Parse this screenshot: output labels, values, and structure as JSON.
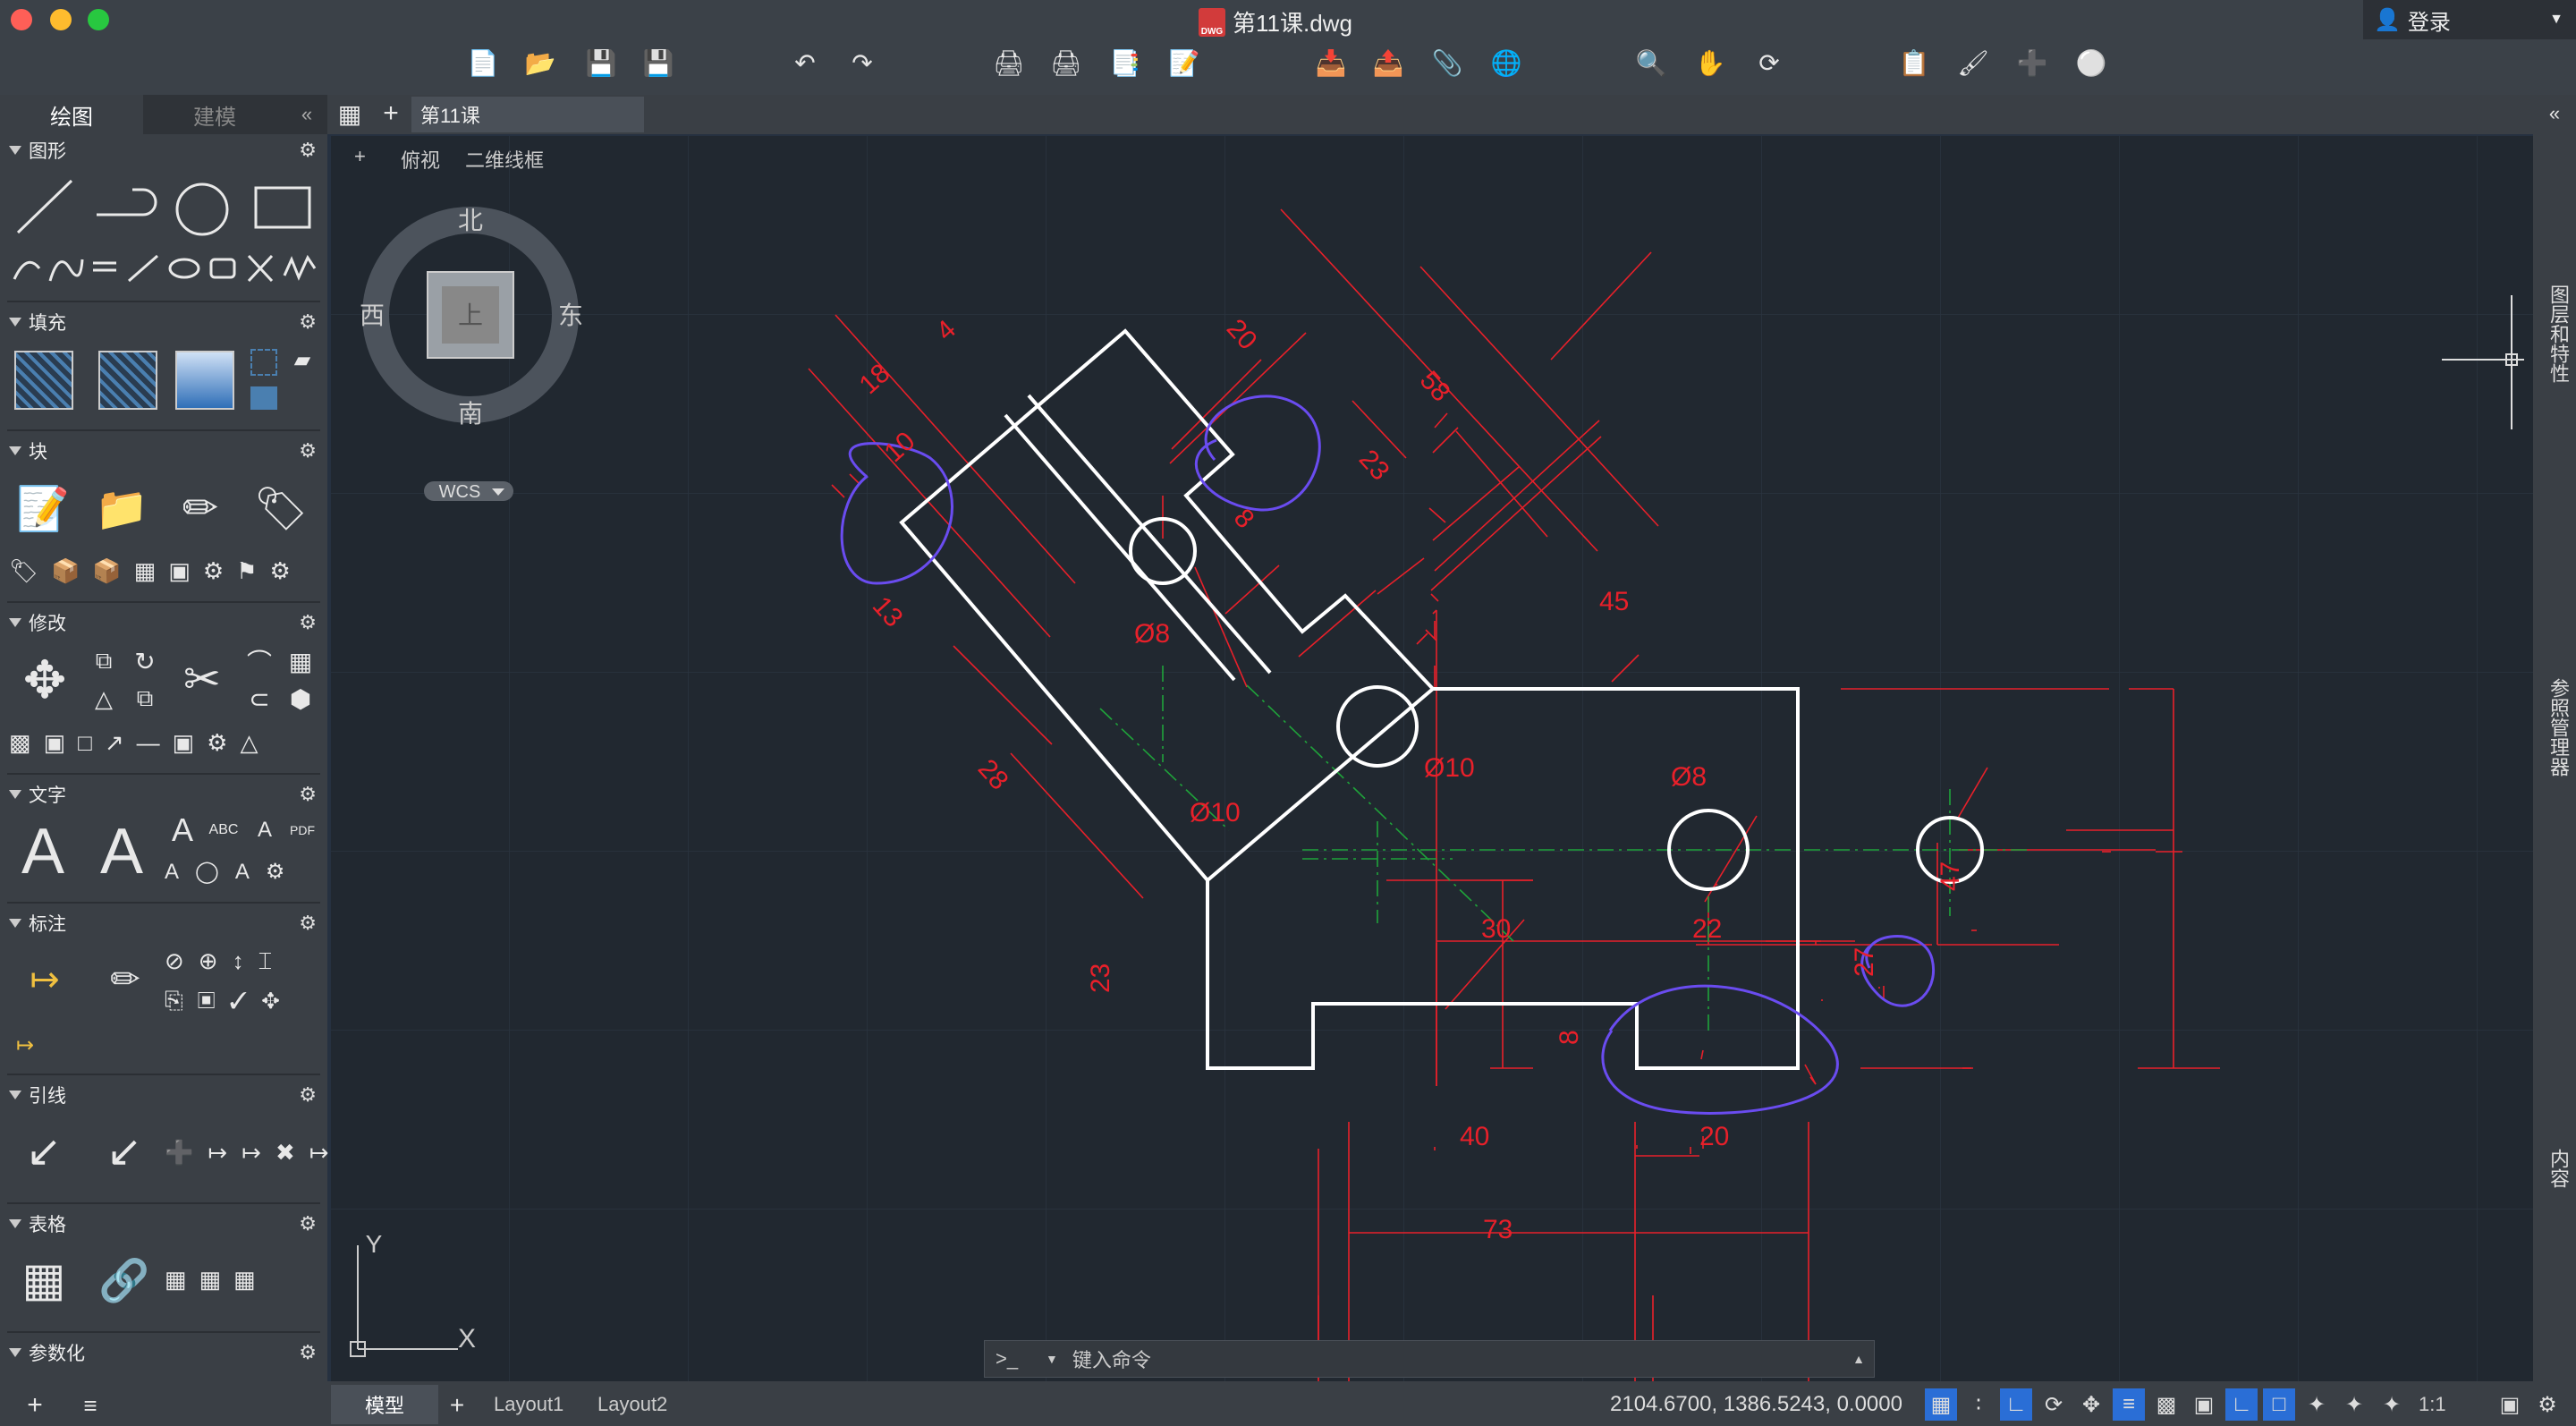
{
  "window": {
    "title": "第11课.dwg",
    "file_badge": "DWG",
    "login_label": "登录"
  },
  "left_panel": {
    "tabs": [
      "绘图",
      "建模"
    ],
    "sections": [
      "图形",
      "填充",
      "块",
      "修改",
      "文字",
      "标注",
      "引线",
      "表格",
      "参数化"
    ]
  },
  "doc_tab": "第11课",
  "viewport": {
    "controls": "+",
    "view": "俯视",
    "style": "二维线框",
    "wcs": "WCS"
  },
  "viewcube": {
    "north": "北",
    "south": "南",
    "east": "东",
    "west": "西",
    "top": "上"
  },
  "ucs": {
    "y": "Y",
    "x": "X"
  },
  "right_panels": [
    "图层和特性",
    "参照管理器",
    "内容"
  ],
  "command": {
    "prompt": ">_",
    "placeholder": "键入命令"
  },
  "layout_tabs": [
    "模型",
    "Layout1",
    "Layout2"
  ],
  "status": {
    "coords": "2104.6700, 1386.5243, 0.0000",
    "scale": "1:1"
  },
  "dims": {
    "d18": "18",
    "d4": "4",
    "d20": "20",
    "d58": "58",
    "d10": "10",
    "d23a": "23",
    "d8a": "8",
    "d13": "13",
    "d28": "28",
    "phi8a": "Ø8",
    "phi10a": "Ø10",
    "d45": "45",
    "phi10b": "Ø10",
    "phi8b": "Ø8",
    "d47": "47",
    "d30": "30",
    "d22": "22",
    "d27": "27",
    "d23b": "23",
    "d8b": "8",
    "d40": "40",
    "d20b": "20",
    "d73": "73"
  },
  "colors": {
    "dimension": "#e8202a",
    "geometry": "#ffffff",
    "annotation": "#6a4cf0",
    "centerline": "#1fa33a"
  }
}
